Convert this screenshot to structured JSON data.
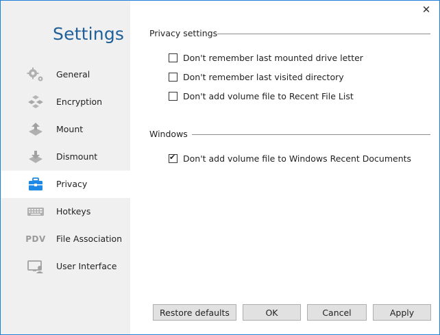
{
  "window": {
    "title": "Settings",
    "close_glyph": "✕"
  },
  "sidebar": {
    "items": [
      {
        "label": "General",
        "icon": "gears-icon"
      },
      {
        "label": "Encryption",
        "icon": "encryption-icon"
      },
      {
        "label": "Mount",
        "icon": "mount-icon"
      },
      {
        "label": "Dismount",
        "icon": "dismount-icon"
      },
      {
        "label": "Privacy",
        "icon": "privacy-briefcase-icon",
        "active": true
      },
      {
        "label": "Hotkeys",
        "icon": "keyboard-icon"
      },
      {
        "label": "File Association",
        "icon": "pdv-icon",
        "icon_text": "PDV"
      },
      {
        "label": "User Interface",
        "icon": "user-interface-icon"
      }
    ]
  },
  "privacy_group": {
    "title": "Privacy settings",
    "options": [
      {
        "label": "Don't remember last mounted drive letter",
        "checked": false
      },
      {
        "label": "Don't remember last visited directory",
        "checked": false
      },
      {
        "label": "Don't add volume file to Recent File List",
        "checked": false
      }
    ]
  },
  "windows_group": {
    "title": "Windows",
    "options": [
      {
        "label": "Don't add volume file to Windows Recent Documents",
        "checked": true
      }
    ]
  },
  "buttons": {
    "restore": "Restore defaults",
    "ok": "OK",
    "cancel": "Cancel",
    "apply": "Apply"
  },
  "colors": {
    "accent": "#1f5f9a",
    "icon_blue": "#1e88e5",
    "icon_gray": "#9a9a9a"
  }
}
